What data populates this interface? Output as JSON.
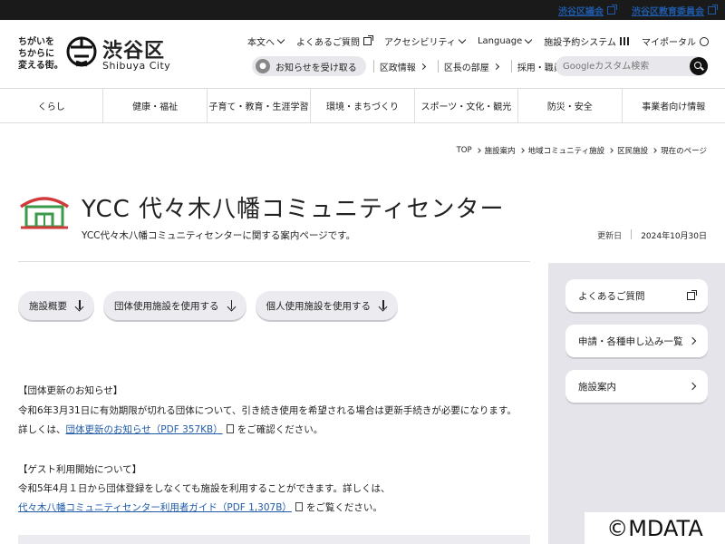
{
  "topbar": {
    "links": [
      "渋谷区議会",
      "渋谷区教育委員会"
    ]
  },
  "logo": {
    "tagline_lines": [
      "ちがいを",
      "ちからに",
      "変える街。"
    ],
    "name_jp": "渋谷区",
    "name_en": "Shibuya City"
  },
  "utility": {
    "text_size": "本文へ",
    "faq": "よくあるご質問",
    "accessibility": "アクセシビリティ",
    "language": "Language",
    "facility_booking": "施設予約システム",
    "my_portal": "マイポータル"
  },
  "row2": {
    "notify": "お知らせを受け取る",
    "links": [
      "区政情報",
      "区長の部屋",
      "採用・職員情報"
    ]
  },
  "search": {
    "placeholder": "Googleカスタム検索"
  },
  "mainnav": [
    "くらし",
    "健康・福祉",
    "子育て・教育・生涯学習",
    "環境・まちづくり",
    "スポーツ・文化・観光",
    "防災・安全",
    "事業者向け情報"
  ],
  "breadcrumb": [
    "TOP",
    "施設案内",
    "地域コミュニティ施設",
    "区民施設",
    "現在のページ"
  ],
  "page": {
    "title": "YCC 代々木八幡コミュニティセンター",
    "desc": "YCC代々木八幡コミュニティセンターに関する案内ページです。",
    "updated_label": "更新日",
    "updated_date": "2024年10月30日"
  },
  "anchors": [
    "施設概要",
    "団体使用施設を使用する",
    "個人使用施設を使用する"
  ],
  "notice1": {
    "heading": "【団体更新のお知らせ】",
    "line1": "令和6年3月31日に有効期限が切れる団体について、引き続き使用を希望される場合は更新手続きが必要になります。",
    "pre": "詳しくは、",
    "link": "団体更新のお知らせ（PDF 357KB）",
    "post": "をご確認ください。"
  },
  "notice2": {
    "heading": "【ゲスト利用開始について】",
    "line1": "令和5年4月１日から団体登録をしなくても施設を利用することができます。詳しくは、",
    "link": "代々木八幡コミュニティセンター利用者ガイド（PDF 1,307B）",
    "post": "をご覧ください。"
  },
  "sidebar": [
    "よくあるご質問",
    "申請・各種申し込み一覧",
    "施設案内"
  ],
  "watermark": "©MDATA",
  "colors": {
    "link": "#1f5aa8",
    "icon_red": "#d23a3a",
    "icon_green": "#3a9a4a"
  }
}
